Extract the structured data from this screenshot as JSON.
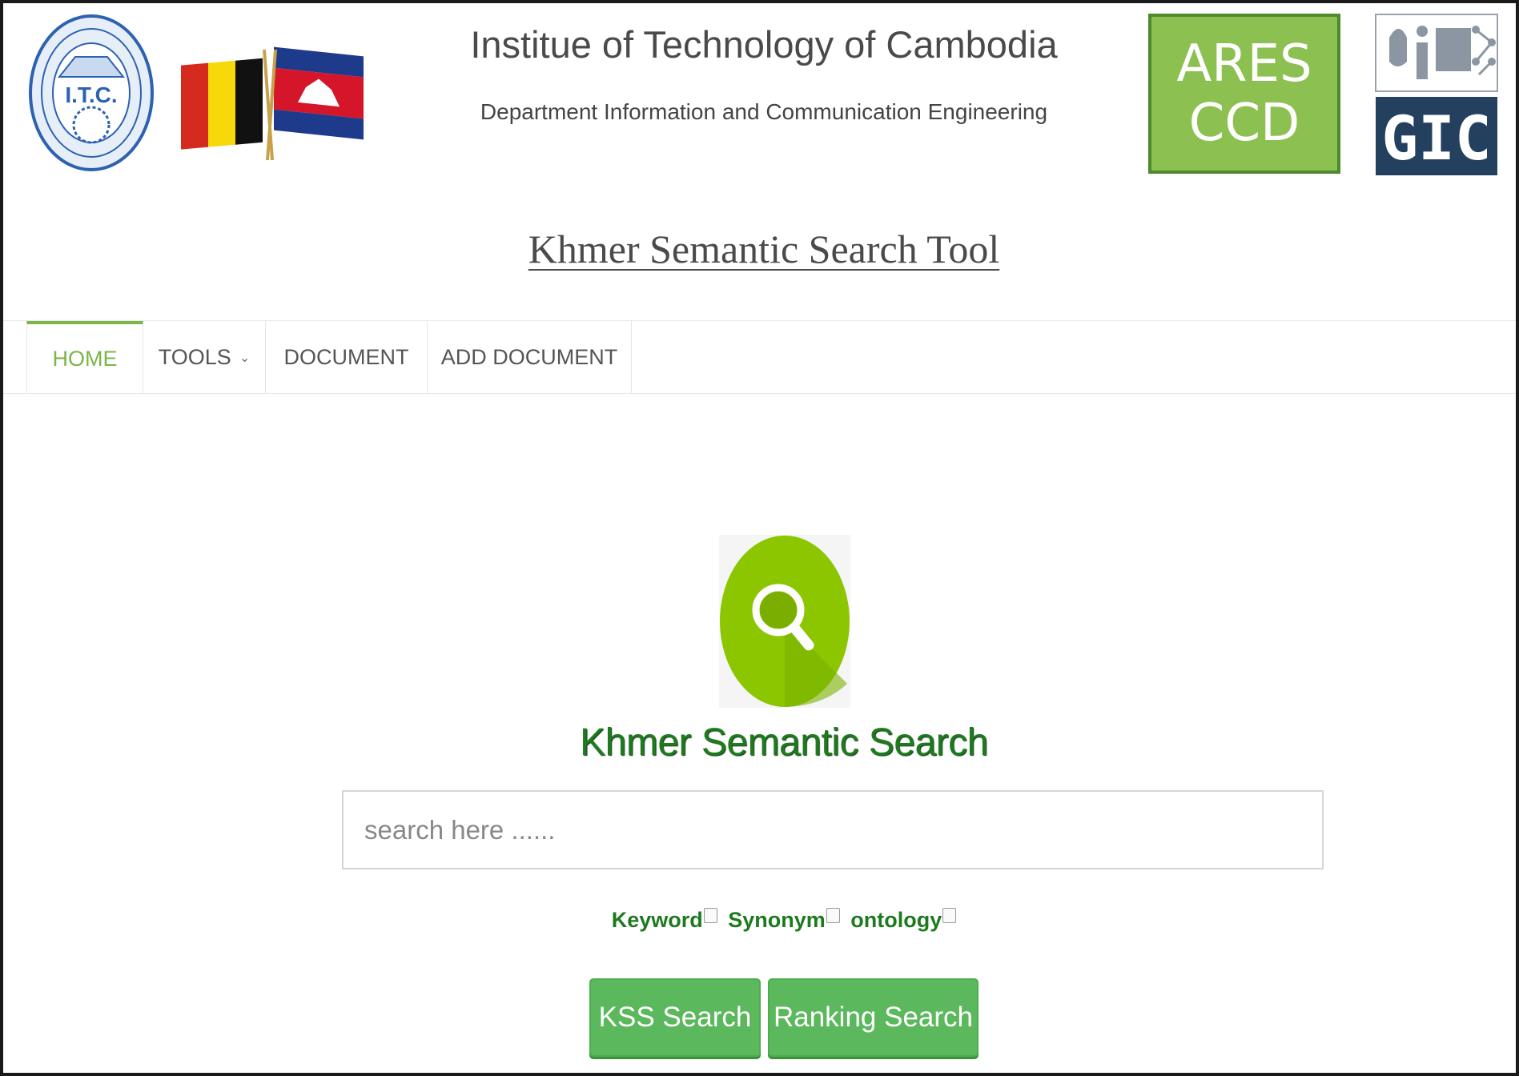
{
  "header": {
    "institute": "Institue of Technology of Cambodia",
    "department": "Department Information and Communication Engineering",
    "tool_title": "Khmer Semantic Search Tool",
    "logos": {
      "itc": "I.T.C.",
      "ares_line1": "ARES",
      "ares_line2": "CCD",
      "gic": "GIC"
    }
  },
  "nav": {
    "items": [
      {
        "label": "HOME",
        "active": true
      },
      {
        "label": "TOOLS",
        "has_dropdown": true
      },
      {
        "label": "DOCUMENT"
      },
      {
        "label": "ADD DOCUMENT"
      }
    ]
  },
  "main": {
    "title": "Khmer Semantic Search",
    "search": {
      "placeholder": "search here ......",
      "value": ""
    },
    "options": [
      {
        "label": "Keyword",
        "checked": false
      },
      {
        "label": "Synonym",
        "checked": false
      },
      {
        "label": "ontology",
        "checked": false
      }
    ],
    "buttons": {
      "kss": "KSS Search",
      "ranking": "Ranking Search"
    }
  },
  "colors": {
    "accent": "#7ab648",
    "title_green": "#1e7a1e",
    "button_green": "#5cb85c",
    "ares_green": "#8cc152",
    "gic_navy": "#23405e"
  }
}
